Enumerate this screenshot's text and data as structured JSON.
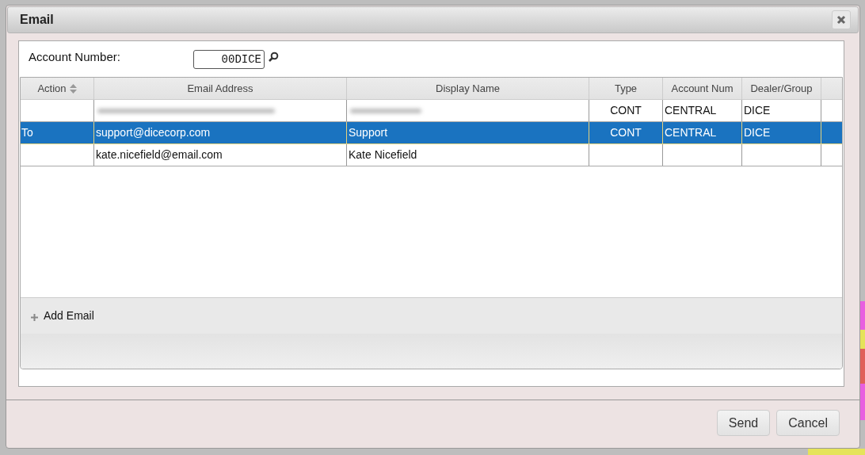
{
  "window": {
    "title": "Email"
  },
  "account": {
    "label": "Account Number:",
    "value": "00DICE"
  },
  "table": {
    "columns": [
      {
        "label": "Action",
        "sortable": true
      },
      {
        "label": "Email Address",
        "sortable": false
      },
      {
        "label": "Display Name",
        "sortable": false
      },
      {
        "label": "Type",
        "sortable": false
      },
      {
        "label": "Account Num",
        "sortable": false
      },
      {
        "label": "Dealer/Group",
        "sortable": false
      }
    ],
    "rows": [
      {
        "selected": false,
        "cells": [
          {
            "kind": "text",
            "text": ""
          },
          {
            "kind": "redacted"
          },
          {
            "kind": "redacted"
          },
          {
            "kind": "text",
            "text": "CONT"
          },
          {
            "kind": "text",
            "text": "CENTRAL"
          },
          {
            "kind": "text",
            "text": "DICE"
          }
        ]
      },
      {
        "selected": true,
        "cells": [
          {
            "kind": "text",
            "text": "To"
          },
          {
            "kind": "text",
            "text": "support@dicecorp.com"
          },
          {
            "kind": "text",
            "text": "Support"
          },
          {
            "kind": "text",
            "text": "CONT"
          },
          {
            "kind": "text",
            "text": "CENTRAL"
          },
          {
            "kind": "text",
            "text": "DICE"
          }
        ]
      },
      {
        "selected": false,
        "cells": [
          {
            "kind": "text",
            "text": ""
          },
          {
            "kind": "text",
            "text": "kate.nicefield@email.com"
          },
          {
            "kind": "text",
            "text": "Kate Nicefield"
          },
          {
            "kind": "text",
            "text": ""
          },
          {
            "kind": "text",
            "text": ""
          },
          {
            "kind": "text",
            "text": ""
          }
        ]
      }
    ]
  },
  "add_button": {
    "label": "Add Email"
  },
  "buttons": [
    "Send",
    "Cancel"
  ]
}
